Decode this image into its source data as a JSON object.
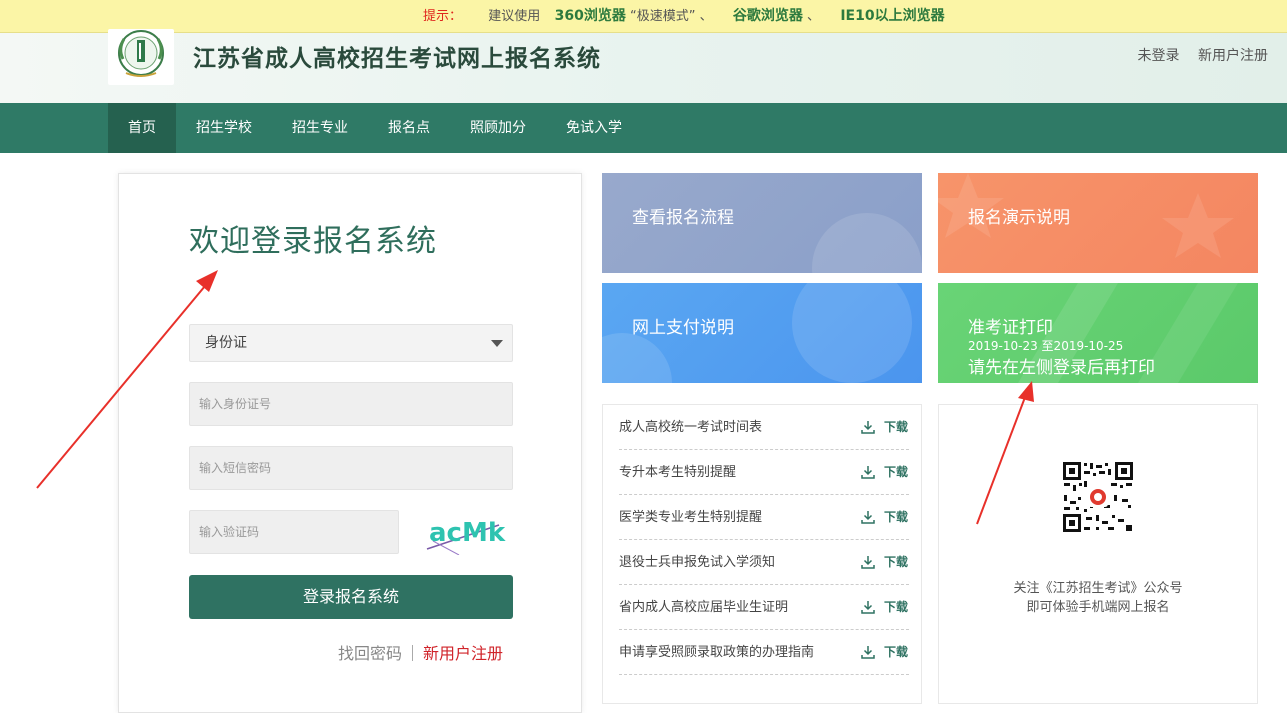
{
  "tip": {
    "label": "提示：",
    "suggest": "建议使用",
    "browser1": "360浏览器",
    "mode": "“极速模式”",
    "sep1": "、",
    "browser2": "谷歌浏览器",
    "sep2": "、",
    "browser3": "IE10以上浏览器"
  },
  "header": {
    "title": "江苏省成人高校招生考试网上报名系统",
    "not_logged_in": "未登录",
    "register": "新用户注册"
  },
  "nav": {
    "items": [
      {
        "label": "首页",
        "active": true
      },
      {
        "label": "招生学校"
      },
      {
        "label": "招生专业"
      },
      {
        "label": "报名点"
      },
      {
        "label": "照顾加分"
      },
      {
        "label": "免试入学"
      }
    ]
  },
  "login": {
    "title": "欢迎登录报名系统",
    "id_type": "身份证",
    "id_placeholder": "输入身份证号",
    "sms_placeholder": "输入短信密码",
    "captcha_placeholder": "输入验证码",
    "captcha_text": "acMk",
    "submit": "登录报名系统",
    "forgot": "找回密码",
    "register": "新用户注册"
  },
  "tiles": {
    "process": "查看报名流程",
    "demo": "报名演示说明",
    "payment": "网上支付说明",
    "ticket": {
      "title": "准考证打印",
      "dates": "2019-10-23 至2019-10-25",
      "note": "请先在左侧登录后再打印"
    }
  },
  "downloads": {
    "button_label": "下载",
    "items": [
      "成人高校统一考试时间表",
      "专升本考生特别提醒",
      "医学类专业考生特别提醒",
      "退役士兵申报免试入学须知",
      "省内成人高校应届毕业生证明",
      "申请享受照顾录取政策的办理指南"
    ]
  },
  "qr": {
    "line1": "关注《江苏招生考试》公众号",
    "line2": "即可体验手机端网上报名"
  },
  "colors": {
    "primary": "#2f7a66",
    "tip_bg": "#fbf5a6",
    "red": "#d0242a",
    "arrow": "#e8302a"
  }
}
